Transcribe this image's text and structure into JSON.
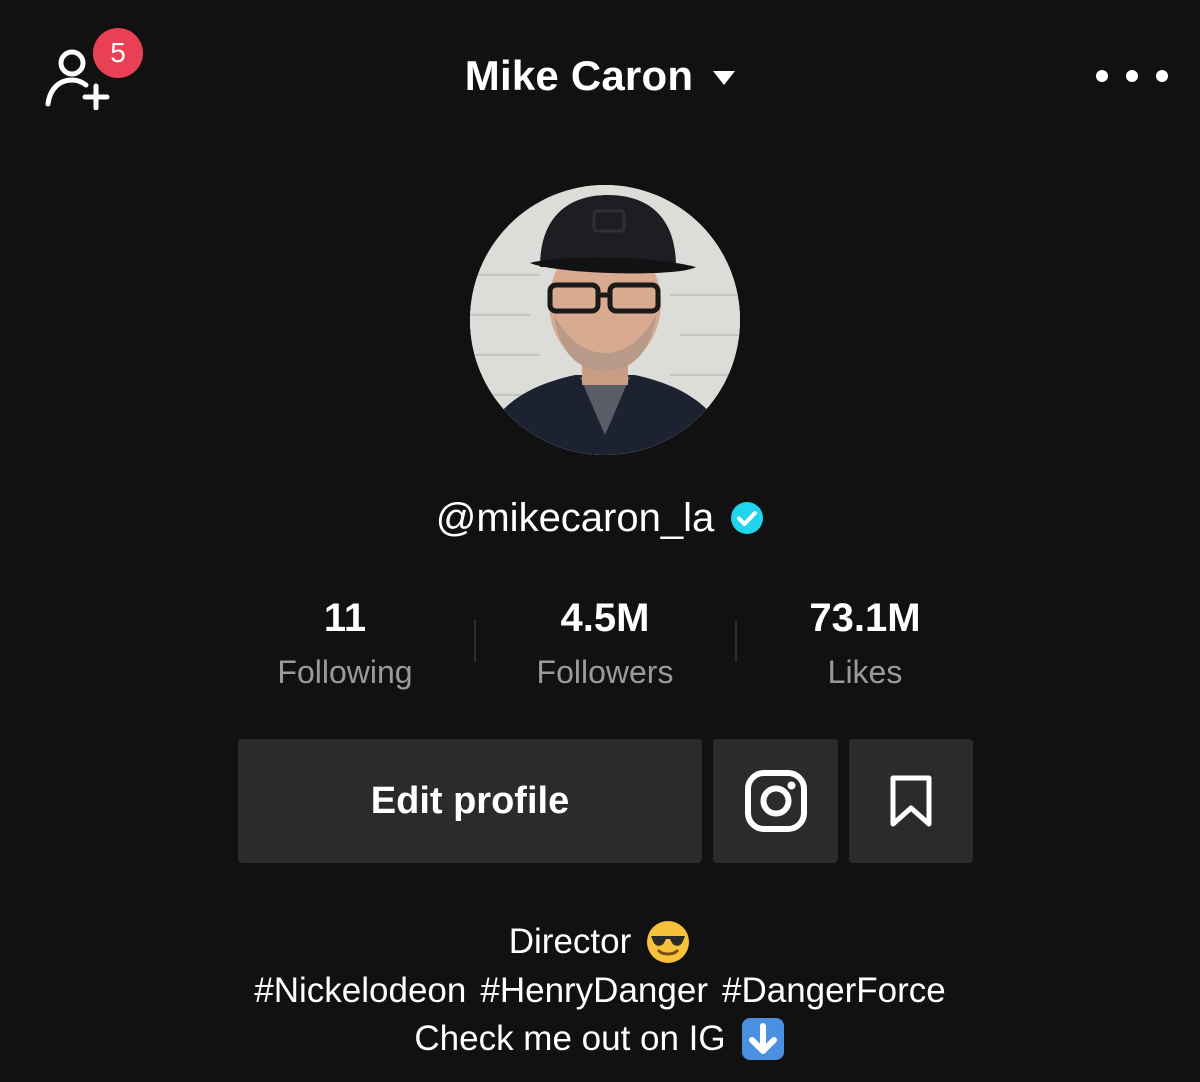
{
  "header": {
    "notification_count": "5",
    "account_name": "Mike Caron"
  },
  "profile": {
    "username": "@mikecaron_la",
    "verified_color": "#20d5ec"
  },
  "stats": [
    {
      "value": "11",
      "label": "Following"
    },
    {
      "value": "4.5M",
      "label": "Followers"
    },
    {
      "value": "73.1M",
      "label": "Likes"
    }
  ],
  "actions": {
    "edit_profile_label": "Edit profile",
    "instagram_icon": "instagram-icon",
    "favorites_icon": "bookmark-icon"
  },
  "bio": {
    "line1": "Director",
    "line1_emoji": "sunglasses-emoji",
    "hashtags": [
      "#Nickelodeon",
      "#HenryDanger",
      "#DangerForce"
    ],
    "line3": "Check me out on IG",
    "line3_emoji": "down-arrow-emoji"
  },
  "colors": {
    "background": "#111111",
    "badge": "#ea4056",
    "button_bg": "#2b2b2b",
    "secondary_text": "#9a9a9a"
  }
}
